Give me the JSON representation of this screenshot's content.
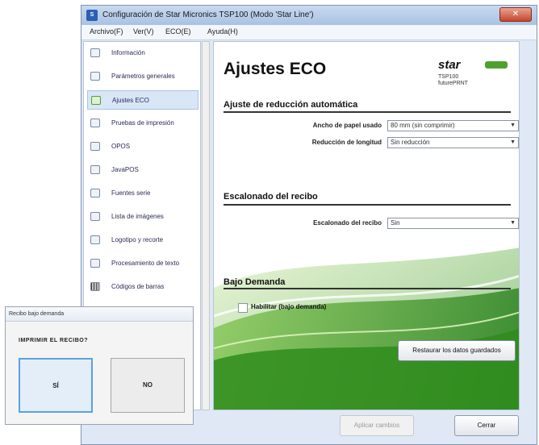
{
  "window": {
    "title": "Configuración de Star Micronics TSP100 (Modo 'Star Line')",
    "close_label": "✕"
  },
  "menu": [
    "Archivo(F)",
    "Ver(V)",
    "ECO(E)",
    "Ayuda(H)"
  ],
  "sidebar": {
    "items": [
      {
        "label": "Información",
        "icon": "info-icon"
      },
      {
        "label": "Parámetros generales",
        "icon": "settings-icon"
      },
      {
        "label": "Ajustes ECO",
        "icon": "leaf-icon",
        "selected": true
      },
      {
        "label": "Pruebas de impresión",
        "icon": "printer-icon"
      },
      {
        "label": "OPOS",
        "icon": "opos-icon"
      },
      {
        "label": "JavaPOS",
        "icon": "java-icon"
      },
      {
        "label": "Fuentes serie",
        "icon": "font-icon"
      },
      {
        "label": "Lista de imágenes",
        "icon": "image-icon"
      },
      {
        "label": "Logotipo y recorte",
        "icon": "logo-icon"
      },
      {
        "label": "Procesamiento de texto",
        "icon": "text-icon"
      },
      {
        "label": "Códigos de barras",
        "icon": "barcode-icon"
      }
    ]
  },
  "panel": {
    "title": "Ajustes ECO",
    "logo": {
      "brand": "star",
      "sub": "TSP100\nfuturePRNT"
    },
    "section1": {
      "title": "Ajuste de reducción automática",
      "paper_width_label": "Ancho de papel usado",
      "paper_width_value": "80 mm (sin comprimir)",
      "length_reduction_label": "Reducción de longitud",
      "length_reduction_value": "Sin reducción"
    },
    "section2": {
      "title": "Escalonado del recibo",
      "stagger_label": "Escalonado del recibo",
      "stagger_value": "Sin"
    },
    "section3": {
      "title": "Bajo Demanda",
      "enable_label": "Habilitar (bajo demanda)",
      "enable_checked": false
    },
    "restore_button": "Restaurar los datos guardados"
  },
  "buttons": {
    "apply": "Aplicar cambios",
    "close": "Cerrar"
  },
  "dialog": {
    "title": "Recibo bajo demanda",
    "prompt": "IMPRIMIR EL RECIBO?",
    "yes": "SÍ",
    "no": "NO"
  },
  "colors": {
    "accent_green": "#4fa12f",
    "selection": "#d8e6f6",
    "dialog_focus": "#5ba2df"
  }
}
